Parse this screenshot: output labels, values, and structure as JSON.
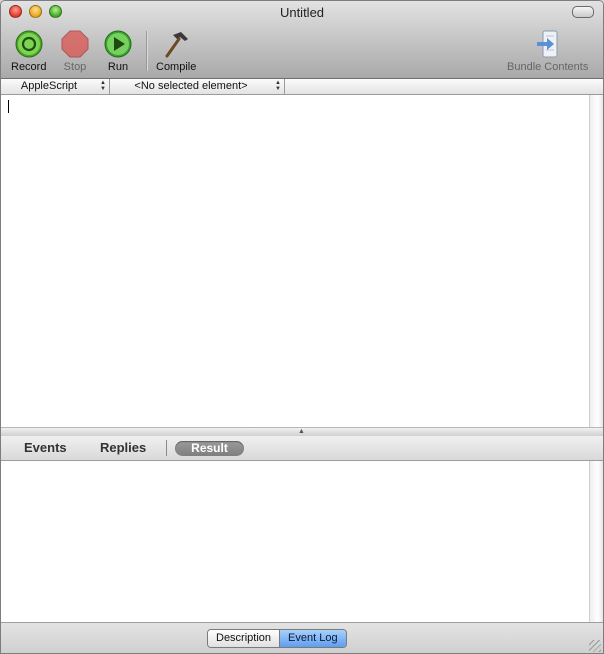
{
  "window": {
    "title": "Untitled"
  },
  "toolbar": {
    "record": {
      "label": "Record",
      "icon": "record-icon"
    },
    "stop": {
      "label": "Stop",
      "icon": "stop-icon"
    },
    "run": {
      "label": "Run",
      "icon": "run-icon"
    },
    "compile": {
      "label": "Compile",
      "icon": "hammer-icon"
    },
    "bundle_contents": {
      "label": "Bundle Contents",
      "icon": "bundle-contents-icon"
    }
  },
  "navbar": {
    "language": "AppleScript",
    "element": "<No selected element>"
  },
  "tabs": {
    "events": "Events",
    "replies": "Replies",
    "result": "Result"
  },
  "bottom": {
    "description": "Description",
    "event_log": "Event Log"
  },
  "colors": {
    "record_green": "#3fa924",
    "stop_red": "#d9534f",
    "run_green": "#37a52c",
    "selected_segment": "#5f9df0"
  }
}
